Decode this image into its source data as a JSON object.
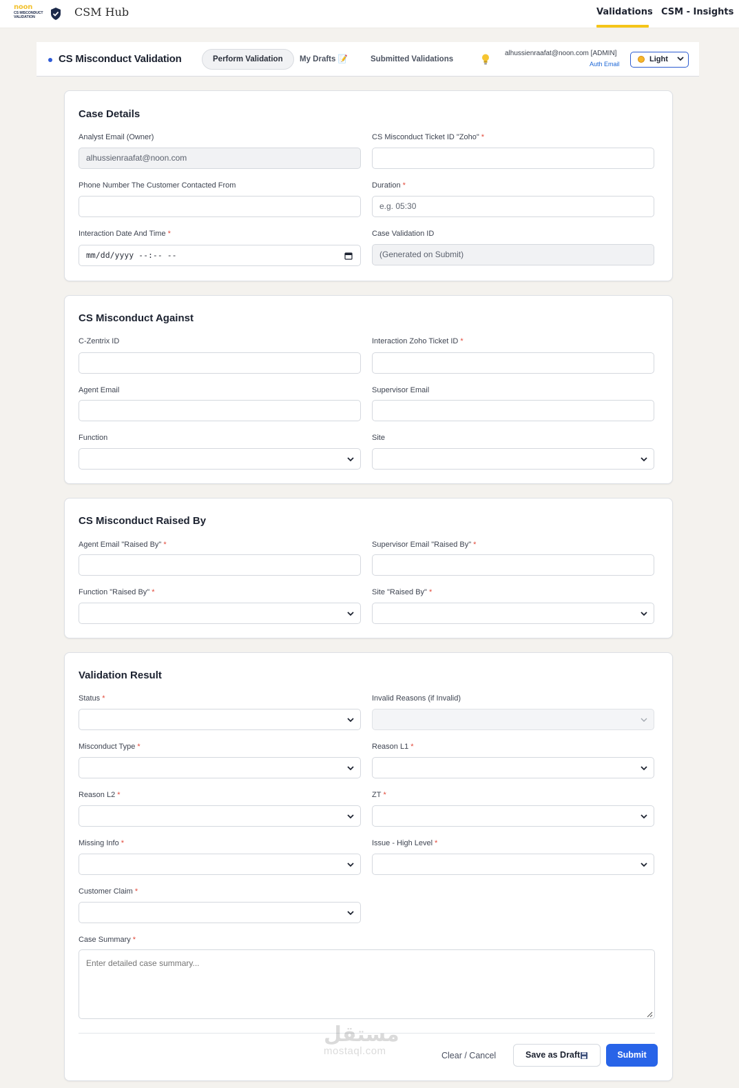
{
  "topbar": {
    "logo_noon": "noon",
    "logo_line1": "CS MISCONDUCT",
    "logo_line2": "VALIDATION",
    "hub_title": "CSM Hub",
    "nav": [
      "Validations",
      "CSM - Insights"
    ],
    "active_nav": "Validations",
    "accent": "#f5c518"
  },
  "subheader": {
    "title": "CS Misconduct Validation",
    "tabs": [
      "Perform Validation",
      "My Drafts 📝",
      "Submitted Validations"
    ],
    "active_tab": "Perform Validation",
    "user_email": "alhussienraafat@noon.com [ADMIN]",
    "auth_email": "Auth Email",
    "theme": "Light",
    "bulb_icon": "lightbulb-icon"
  },
  "case_details": {
    "title": "Case Details",
    "analyst_email_label": "Analyst Email (Owner)",
    "analyst_email_value": "alhussienraafat@noon.com",
    "ticket_label": "CS Misconduct Ticket ID \"Zoho\"",
    "phone_label": "Phone Number The Customer Contacted From",
    "duration_label": "Duration",
    "duration_placeholder": "e.g. 05:30",
    "interaction_label": "Interaction Date And Time",
    "interaction_value": "mm/dd/yyyy --:-- --",
    "validation_id_label": "Case Validation ID",
    "validation_id_value": "(Generated on Submit)"
  },
  "against": {
    "title": "CS Misconduct Against",
    "czentrix_label": "C-Zentrix ID",
    "zoho_ticket_label": "Interaction Zoho Ticket ID",
    "agent_email_label": "Agent Email",
    "supervisor_email_label": "Supervisor Email",
    "function_label": "Function",
    "site_label": "Site"
  },
  "raised_by": {
    "title": "CS Misconduct Raised By",
    "agent_email_label": "Agent Email \"Raised By\"",
    "supervisor_email_label": "Supervisor Email \"Raised By\"",
    "function_label": "Function \"Raised By\"",
    "site_label": "Site \"Raised By\""
  },
  "result": {
    "title": "Validation Result",
    "status_label": "Status",
    "invalid_label": "Invalid Reasons (if Invalid)",
    "misconduct_type_label": "Misconduct Type",
    "reason_l1_label": "Reason L1",
    "reason_l2_label": "Reason L2",
    "zt_label": "ZT",
    "missing_info_label": "Missing Info",
    "issue_label": "Issue - High Level",
    "customer_claim_label": "Customer Claim",
    "summary_label": "Case Summary",
    "summary_placeholder": "Enter detailed case summary..."
  },
  "actions": {
    "clear": "Clear / Cancel",
    "draft": "Save as Draft",
    "submit": "Submit",
    "submit_color": "#2864e8"
  },
  "required_marker": "*",
  "watermark": {
    "ar": "مستقل",
    "en": "mostaql.com"
  }
}
